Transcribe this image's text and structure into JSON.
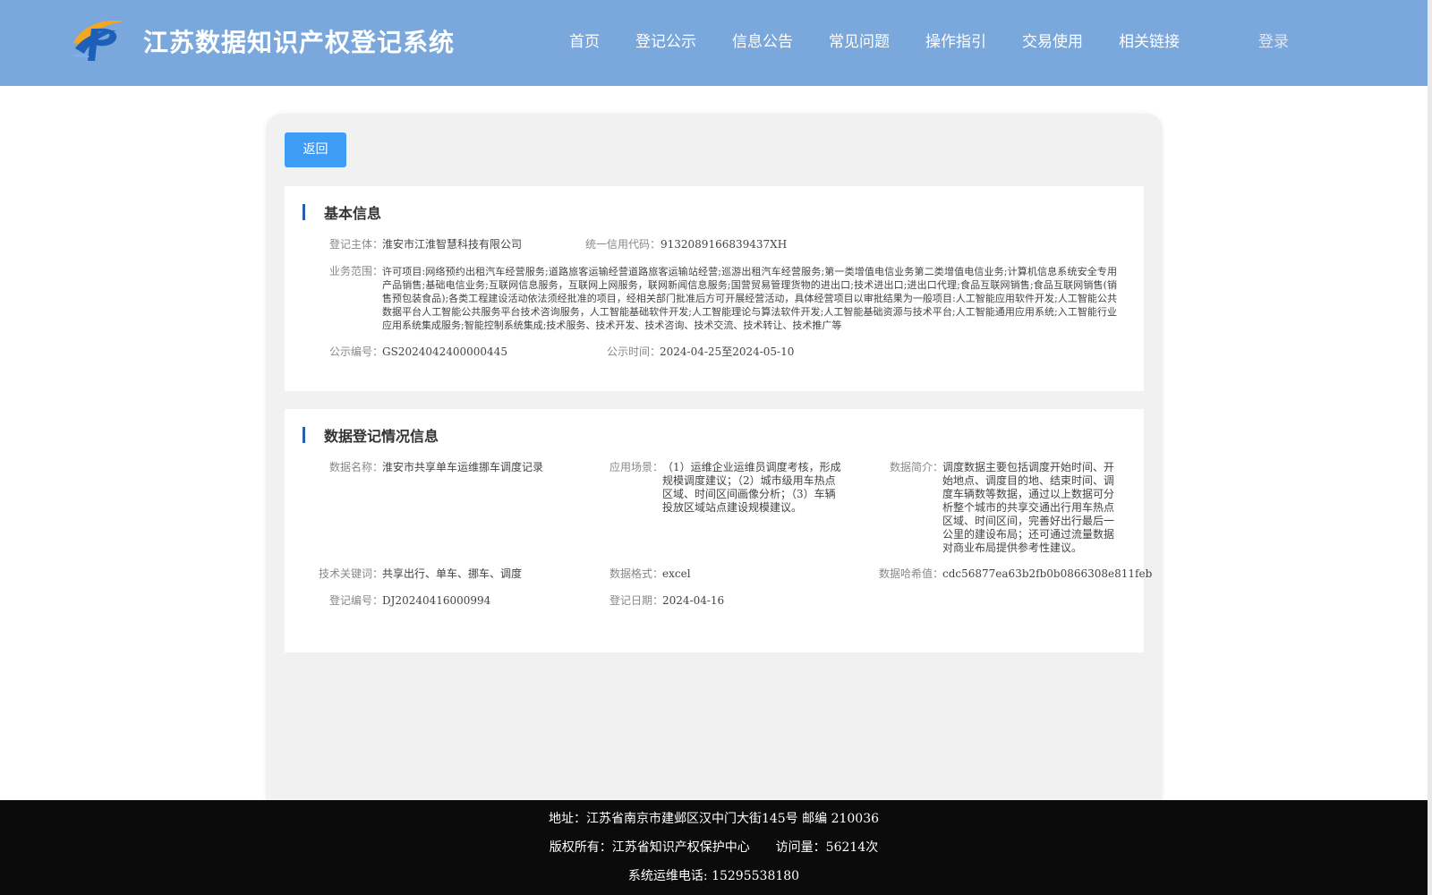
{
  "header": {
    "title": "江苏数据知识产权登记系统",
    "nav": [
      "首页",
      "登记公示",
      "信息公告",
      "常见问题",
      "操作指引",
      "交易使用",
      "相关链接"
    ],
    "login": "登录",
    "logo_icon": "jiangsu-ip-logo-icon"
  },
  "actions": {
    "back": "返回"
  },
  "basic": {
    "title": "基本信息",
    "subject_label": "登记主体：",
    "subject": "淮安市江淮智慧科技有限公司",
    "credit_label": "统一信用代码：",
    "credit": "9132089166839437XH",
    "scope_label": "业务范围：",
    "scope": "许可项目:网络预约出租汽车经营服务;道路旅客运输经营道路旅客运输站经营;巡游出租汽车经营服务;第一类增值电信业务第二类增值电信业务;计算机信息系统安全专用产品销售;基础电信业务;互联网信息服务，互联网上网服务，联网新闻信息服务;国营贸易管理货物的进出口;技术进出口;进出口代理;食品互联网销售;食品互联网销售(销售预包装食品);各类工程建设活动依法须经批准的项目，经相关部门批准后方可开展经营活动，具体经营项目以审批结果为一般项目:人工智能应用软件开发;人工智能公共数据平台人工智能公共服务平台技术咨询服务，人工智能基础软件开发;人工智能理论与算法软件开发;人工智能基础资源与技术平台;人工智能通用应用系统;入工智能行业应用系统集成服务;智能控制系统集成;技术服务、技术开发、技术咨询、技术交流、技术转让、技术推广等",
    "notice_no_label": "公示编号：",
    "notice_no": "GS2024042400000445",
    "notice_time_label": "公示时间：",
    "notice_time": "2024-04-25至2024-05-10"
  },
  "registration": {
    "title": "数据登记情况信息",
    "name_label": "数据名称：",
    "name": "淮安市共享单车运维挪车调度记录",
    "scenario_label": "应用场景：",
    "scenario": "（1）运维企业运维员调度考核，形成规模调度建议；（2）城市级用车热点区域、时间区间画像分析；（3）车辆投放区域站点建设规模建议。",
    "intro_label": "数据简介：",
    "intro": "调度数据主要包括调度开始时间、开始地点、调度目的地、结束时间、调度车辆数等数据，通过以上数据可分析整个城市的共享交通出行用车热点区域、时间区间，完善好出行最后一公里的建设布局；还可通过流量数据对商业布局提供参考性建议。",
    "keywords_label": "技术关键词：",
    "keywords": "共享出行、单车、挪车、调度",
    "format_label": "数据格式：",
    "format": "excel",
    "hash_label": "数据哈希值：",
    "hash": "cdc56877ea63b2fb0b0866308e811feb",
    "reg_no_label": "登记编号：",
    "reg_no": "DJ20240416000994",
    "reg_date_label": "登记日期：",
    "reg_date": "2024-04-16"
  },
  "footer": {
    "address": "地址：江苏省南京市建邺区汉中门大街145号 邮编 210036",
    "copyright": "版权所有：江苏省知识产权保护中心",
    "visits": "访问量：56214次",
    "phone": "系统运维电话: 15295538180"
  },
  "colors": {
    "header_bg": "#7aa8dc",
    "back_button": "#3f9cf5",
    "section_bar": "#2a5ea8",
    "footer_bg": "#0b0b0b"
  }
}
